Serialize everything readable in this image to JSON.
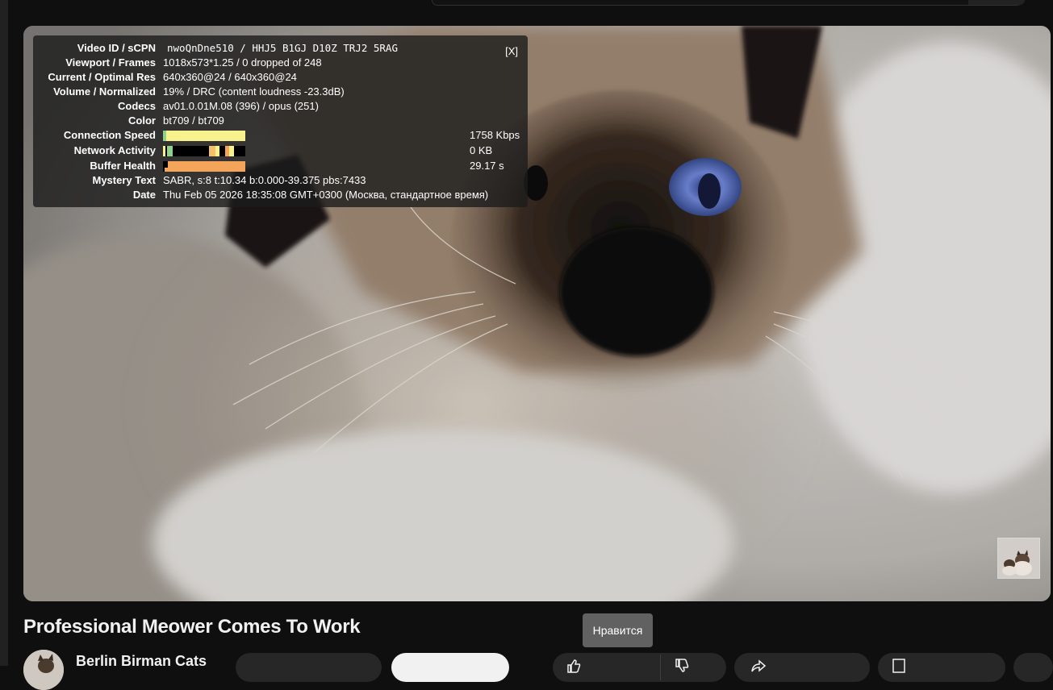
{
  "stats": {
    "close_label": "[X]",
    "rows": {
      "video_id": {
        "label": "Video ID / sCPN",
        "value": "nwoQnDne510 / HHJ5 B1GJ D10Z TRJ2 5RAG"
      },
      "viewport": {
        "label": "Viewport / Frames",
        "value": "1018x573*1.25 / 0 dropped of 248"
      },
      "res": {
        "label": "Current / Optimal Res",
        "value": "640x360@24 / 640x360@24"
      },
      "volume": {
        "label": "Volume / Normalized",
        "value": "19% / DRC (content loudness -23.3dB)"
      },
      "codecs": {
        "label": "Codecs",
        "value": "av01.0.01M.08 (396) / opus (251)"
      },
      "color": {
        "label": "Color",
        "value": "bt709 / bt709"
      },
      "speed": {
        "label": "Connection Speed",
        "side": "1758 Kbps"
      },
      "network": {
        "label": "Network Activity",
        "side": "0 KB"
      },
      "buffer": {
        "label": "Buffer Health",
        "side": "29.17 s"
      },
      "mystery": {
        "label": "Mystery Text",
        "value": "SABR, s:8 t:10.34 b:0.000-39.375 pbs:7433"
      },
      "date": {
        "label": "Date",
        "value": "Thu Feb 05 2026 18:35:08 GMT+0300 (Москва, стандартное время)"
      }
    }
  },
  "video": {
    "title": "Professional Meower Comes To Work",
    "channel": "Berlin Birman Cats"
  },
  "tooltip": {
    "text": "Нравится"
  },
  "colors": {
    "page_bg": "#0f0f0f",
    "graph_yellow": "#f8f28e",
    "graph_orange": "#f4a55a",
    "graph_green": "#8fd28a",
    "tooltip_bg": "#616161"
  }
}
